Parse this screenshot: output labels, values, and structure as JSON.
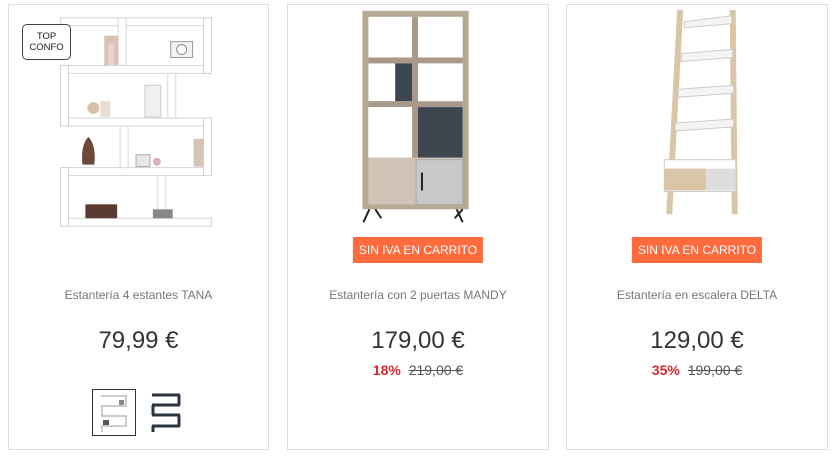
{
  "products": [
    {
      "badge_line1": "TOP",
      "badge_line2": "CONFO",
      "name": "Estantería 4 estantes TANA",
      "price": "79,99 €"
    },
    {
      "promo": "SIN IVA EN CARRITO",
      "name": "Estantería con 2 puertas MANDY",
      "price": "179,00 €",
      "discount": "18%",
      "old_price": "219,00 €"
    },
    {
      "promo": "SIN IVA EN CARRITO",
      "name": "Estantería en escalera DELTA",
      "price": "129,00 €",
      "discount": "35%",
      "old_price": "199,00 €"
    }
  ],
  "colors": {
    "promo_bg": "#ff6b3d",
    "discount": "#d9282f",
    "border": "#dedede"
  }
}
